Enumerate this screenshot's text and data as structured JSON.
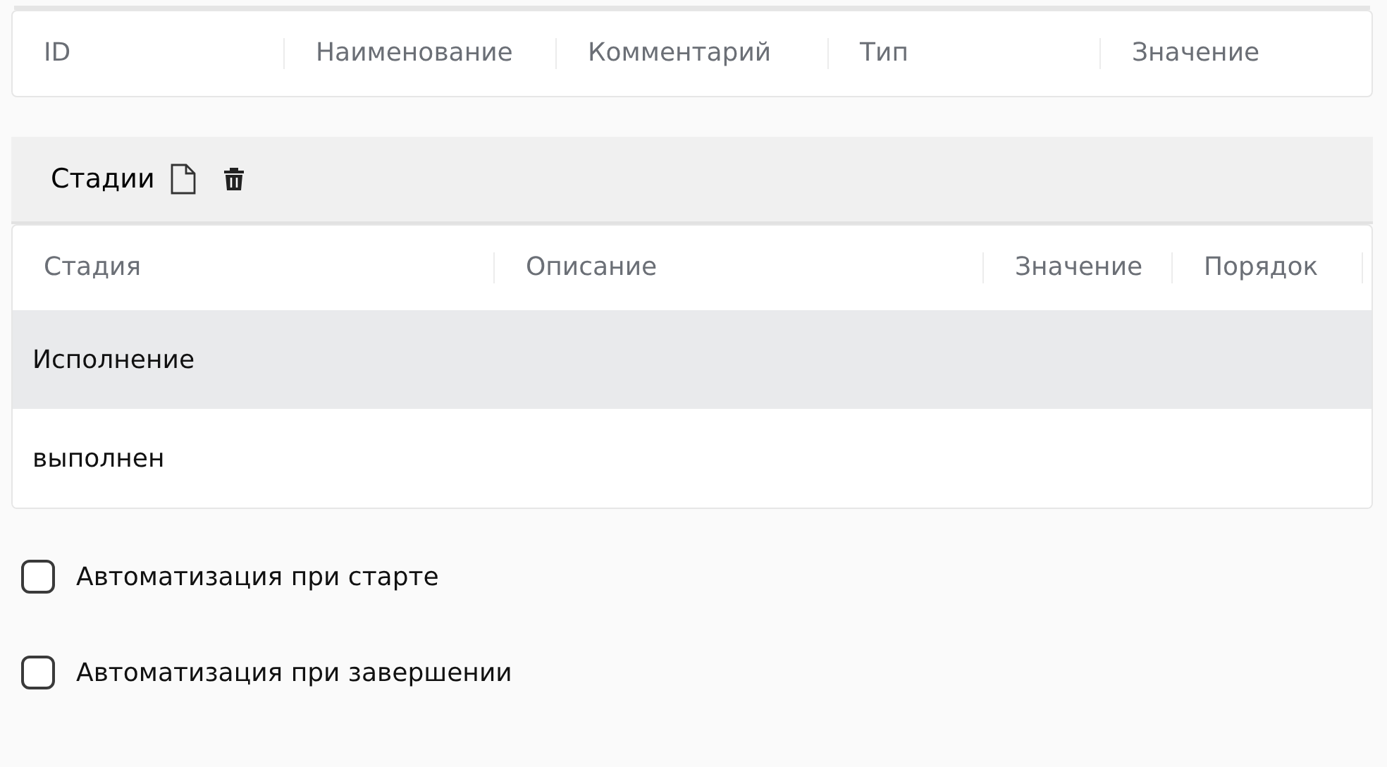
{
  "params_table": {
    "columns": [
      "ID",
      "Наименование",
      "Комментарий",
      "Тип",
      "Значение"
    ]
  },
  "stages": {
    "title": "Стадии",
    "columns": [
      "Стадия",
      "Описание",
      "Значение",
      "Порядок"
    ],
    "rows": [
      {
        "stage": "Исполнение",
        "selected": true
      },
      {
        "stage": "выполнен",
        "selected": false
      }
    ]
  },
  "options": [
    {
      "label": "Автоматизация при старте",
      "checked": false
    },
    {
      "label": "Автоматизация при завершении",
      "checked": false
    }
  ]
}
